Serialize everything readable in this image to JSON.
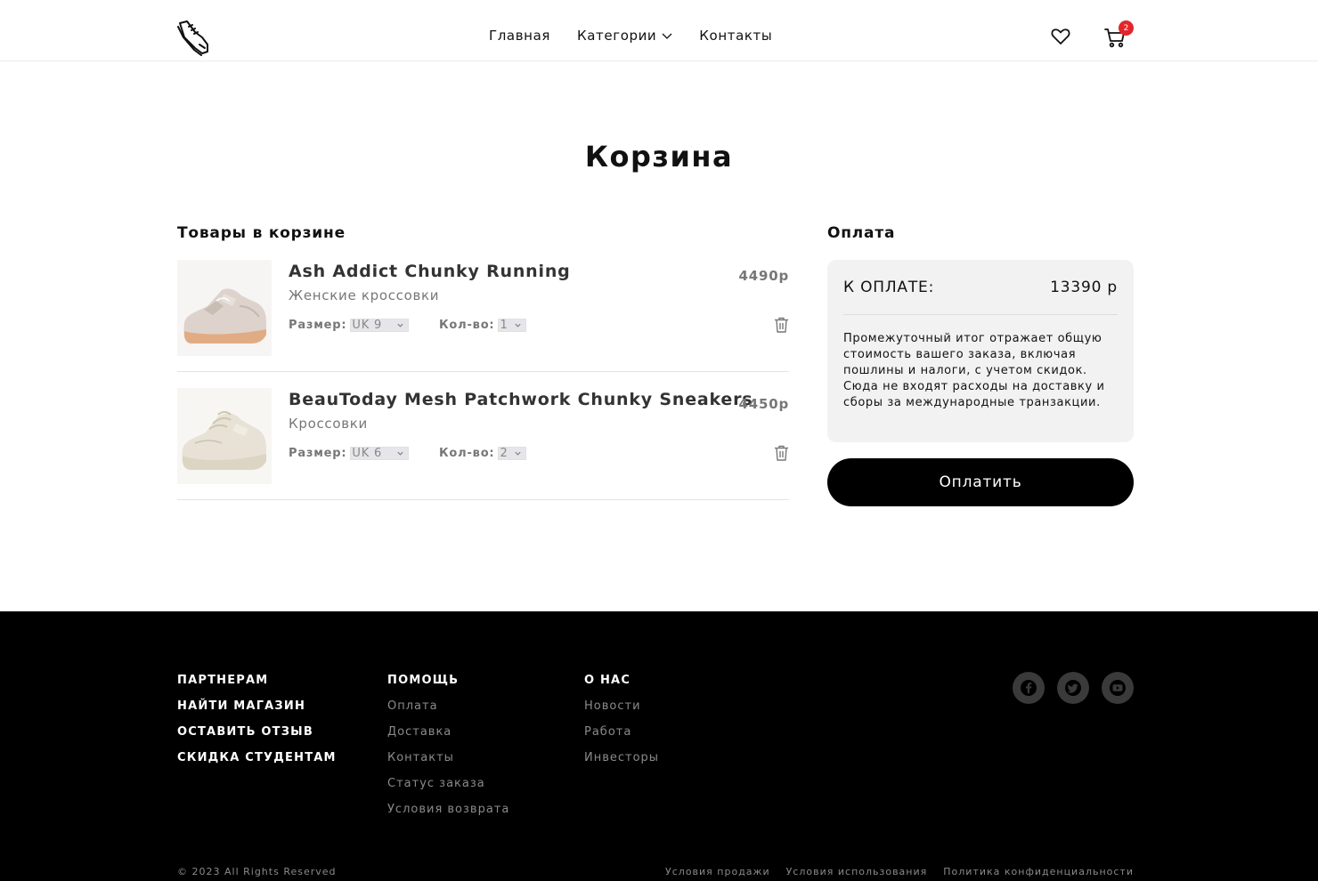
{
  "header": {
    "nav": [
      "Главная",
      "Категории",
      "Контакты"
    ],
    "cart_count": "2"
  },
  "page_title": "Корзина",
  "cart": {
    "title": "Товары в корзине",
    "size_label": "Размер:",
    "qty_label": "Кол-во:",
    "items": [
      {
        "name": "Ash Addict Chunky Running",
        "category": "Женские кроссовки",
        "price": "4490р",
        "size": "UK 9",
        "qty": "1"
      },
      {
        "name": "BeauToday Mesh Patchwork Chunky Sneakers",
        "category": "Кроссовки",
        "price": "4450р",
        "size": "UK 6",
        "qty": "2"
      }
    ]
  },
  "payment": {
    "title": "Оплата",
    "total_label": "К ОПЛАТЕ:",
    "total_value": "13390 р",
    "note": "Промежуточный итог отражает общую стоимость вашего заказа, включая пошлины и налоги, с учетом скидок. Сюда не входят расходы на доставку и сборы за международные транзакции.",
    "button": "Оплатить"
  },
  "footer": {
    "col1": [
      "ПАРТНЕРАМ",
      "НАЙТИ МАГАЗИН",
      "ОСТАВИТЬ ОТЗЫВ",
      "СКИДКА СТУДЕНТАМ"
    ],
    "col2": {
      "title": "ПОМОЩЬ",
      "links": [
        "Оплата",
        "Доставка",
        "Контакты",
        "Статус заказа",
        "Условия возврата"
      ]
    },
    "col3": {
      "title": "О НАС",
      "links": [
        "Новости",
        "Работа",
        "Инвесторы"
      ]
    },
    "social": [
      "facebook-icon",
      "twitter-icon",
      "youtube-icon"
    ],
    "copyright": "© 2023 All Rights Reserved",
    "legal": [
      "Условия продажи",
      "Условия использования",
      "Политика конфиденциальности"
    ]
  },
  "colors": {
    "accent": "#000000",
    "badge": "#e3262b",
    "panel": "#f2f2f2"
  }
}
